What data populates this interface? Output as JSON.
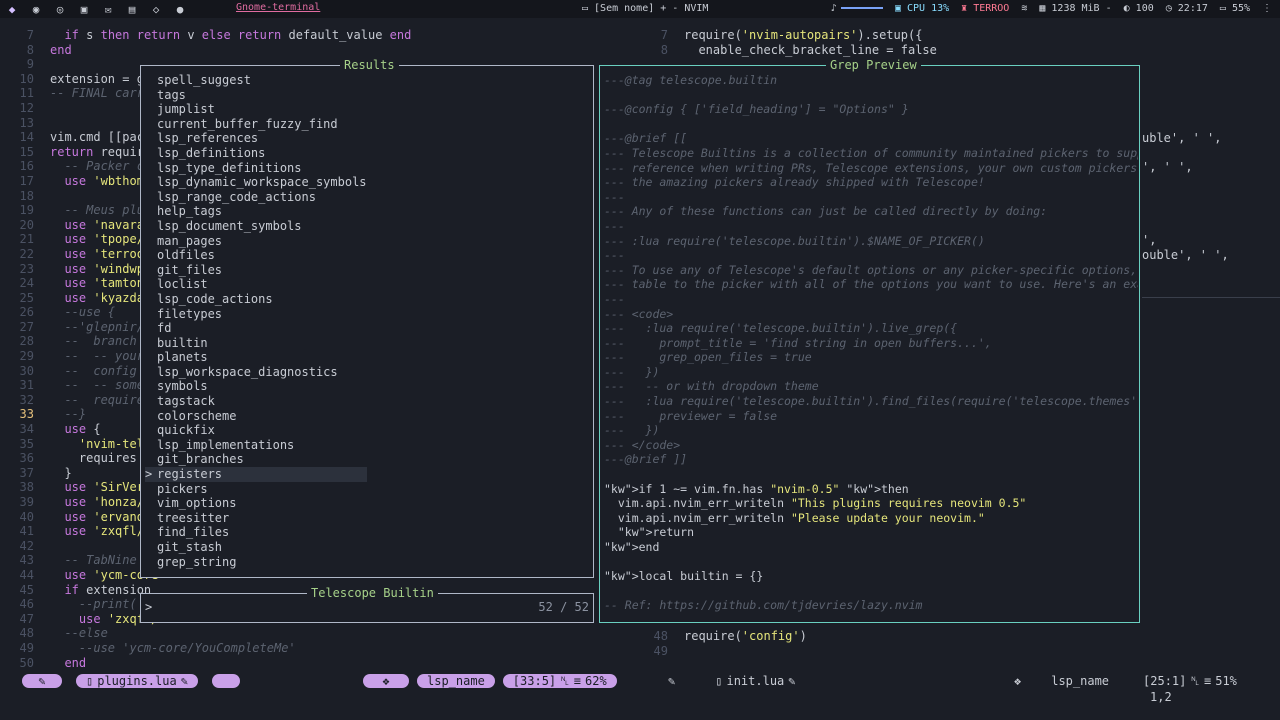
{
  "topbar": {
    "workspace_icons": [
      "arch-icon",
      "firefox-icon",
      "chrome-icon",
      "terminal-icon",
      "mail-icon",
      "folder-icon",
      "code-icon",
      "video-icon"
    ],
    "window_title": "Gnome-terminal",
    "center_title": "[Sem nome] + - NVIM",
    "music_icon": "♪",
    "cpu": "CPU 13%",
    "theme": "TERROO",
    "memory": "1238 MiB",
    "brightness": "100",
    "time": "22:17",
    "battery": "55%",
    "menu": "⋮"
  },
  "left_code": [
    {
      "n": "7",
      "t": "  if s then return v else return default_value end"
    },
    {
      "n": "8",
      "t": "end"
    },
    {
      "n": "9",
      "t": ""
    },
    {
      "n": "10",
      "t": "extension = get"
    },
    {
      "n": "11",
      "t": "-- FINAL carreg"
    },
    {
      "n": "12",
      "t": ""
    },
    {
      "n": "13",
      "t": ""
    },
    {
      "n": "14",
      "t": "vim.cmd [[packa"
    },
    {
      "n": "15",
      "t": "return require("
    },
    {
      "n": "16",
      "t": "  -- Packer can"
    },
    {
      "n": "17",
      "t": "  use 'wbthomas"
    },
    {
      "n": "18",
      "t": ""
    },
    {
      "n": "19",
      "t": "  -- Meus plugi"
    },
    {
      "n": "20",
      "t": "  use 'navarasu"
    },
    {
      "n": "21",
      "t": "  use 'tpope/vi"
    },
    {
      "n": "22",
      "t": "  use 'terroo/v"
    },
    {
      "n": "23",
      "t": "  use 'windwp/n"
    },
    {
      "n": "24",
      "t": "  use 'tamton-a"
    },
    {
      "n": "25",
      "t": "  use 'kyazdani"
    },
    {
      "n": "26",
      "t": "  --use {"
    },
    {
      "n": "27",
      "t": "  --'glepnir/ga"
    },
    {
      "n": "28",
      "t": "  --  branch ="
    },
    {
      "n": "29",
      "t": "  --  -- your s"
    },
    {
      "n": "30",
      "t": "  --  config ="
    },
    {
      "n": "31",
      "t": "  --  -- some o"
    },
    {
      "n": "32",
      "t": "  --  requires"
    },
    {
      "n": "33",
      "t": "  --}"
    },
    {
      "n": "34",
      "t": "  use {"
    },
    {
      "n": "35",
      "t": "    'nvim-teles"
    },
    {
      "n": "36",
      "t": "    requires ="
    },
    {
      "n": "37",
      "t": "  }"
    },
    {
      "n": "38",
      "t": "  use 'SirVer/u"
    },
    {
      "n": "39",
      "t": "  use 'honza/vi"
    },
    {
      "n": "40",
      "t": "  use 'ervandew"
    },
    {
      "n": "41",
      "t": "  use 'zxqfl/ta"
    },
    {
      "n": "42",
      "t": ""
    },
    {
      "n": "43",
      "t": "  -- TabNine ou"
    },
    {
      "n": "44",
      "t": "  use 'ycm-core"
    },
    {
      "n": "45",
      "t": "  if extension"
    },
    {
      "n": "46",
      "t": "    --print( \"A"
    },
    {
      "n": "47",
      "t": "    use 'zxqfl/"
    },
    {
      "n": "48",
      "t": "  --else"
    },
    {
      "n": "49",
      "t": "    --use 'ycm-core/YouCompleteMe'"
    },
    {
      "n": "50",
      "t": "  end"
    }
  ],
  "right_code_top": [
    {
      "n": "7",
      "t": "require('nvim-autopairs').setup({"
    },
    {
      "n": "8",
      "t": "  enable_check_bracket_line = false"
    }
  ],
  "right_code_fragments": [
    "uble', ' ',",
    "', ' ',",
    "',",
    "ouble', ' ',"
  ],
  "right_code_bottom": [
    {
      "n": "48",
      "t": "require('config')"
    },
    {
      "n": "49",
      "t": ""
    }
  ],
  "results": {
    "title": "Results",
    "items": [
      "spell_suggest",
      "tags",
      "jumplist",
      "current_buffer_fuzzy_find",
      "lsp_references",
      "lsp_definitions",
      "lsp_type_definitions",
      "lsp_dynamic_workspace_symbols",
      "lsp_range_code_actions",
      "help_tags",
      "lsp_document_symbols",
      "man_pages",
      "oldfiles",
      "git_files",
      "loclist",
      "lsp_code_actions",
      "filetypes",
      "fd",
      "builtin",
      "planets",
      "lsp_workspace_diagnostics",
      "symbols",
      "tagstack",
      "colorscheme",
      "quickfix",
      "lsp_implementations",
      "git_branches",
      "registers",
      "pickers",
      "vim_options",
      "treesitter",
      "find_files",
      "git_stash",
      "grep_string"
    ],
    "selected": "registers"
  },
  "preview": {
    "title": "Grep Preview",
    "lines": [
      "---@tag telescope.builtin",
      "",
      "---@config { ['field_heading'] = \"Options\" }",
      "",
      "---@brief [[",
      "--- Telescope Builtins is a collection of community maintained pickers to suppor",
      "--- reference when writing PRs, Telescope extensions, your own custom pickers, o",
      "--- the amazing pickers already shipped with Telescope!",
      "---",
      "--- Any of these functions can just be called directly by doing:",
      "---",
      "--- :lua require('telescope.builtin').$NAME_OF_PICKER()",
      "---",
      "--- To use any of Telescope's default options or any picker-specific options, ca",
      "--- table to the picker with all of the options you want to use. Here's an examp",
      "---",
      "--- <code>",
      "---   :lua require('telescope.builtin').live_grep({",
      "---     prompt_title = 'find string in open buffers...',",
      "---     grep_open_files = true",
      "---   })",
      "---   -- or with dropdown theme",
      "---   :lua require('telescope.builtin').find_files(require('telescope.themes').g",
      "---     previewer = false",
      "---   })",
      "--- </code>",
      "---@brief ]]",
      "",
      "if 1 ~= vim.fn.has \"nvim-0.5\" then",
      "  vim.api.nvim_err_writeln \"This plugins requires neovim 0.5\"",
      "  vim.api.nvim_err_writeln \"Please update your neovim.\"",
      "  return",
      "end",
      "",
      "local builtin = {}",
      "",
      "-- Ref: https://github.com/tjdevries/lazy.nvim"
    ]
  },
  "prompt": {
    "title": "Telescope Builtin",
    "caret": ">",
    "count": "52 / 52"
  },
  "statusline_left": {
    "file": "plugins.lua",
    "lsp": "lsp_name",
    "position": "[33:5]",
    "percent": "62%"
  },
  "statusline_right": {
    "file": "init.lua",
    "lsp": "lsp_name",
    "position": "[25:1]",
    "percent": "51%",
    "cmd": "1,2"
  },
  "colors": {
    "accent_pill": "#c9a0e8",
    "results_border": "#b0b8c8",
    "preview_border": "#6ad0c0",
    "title_green": "#a6d189"
  }
}
